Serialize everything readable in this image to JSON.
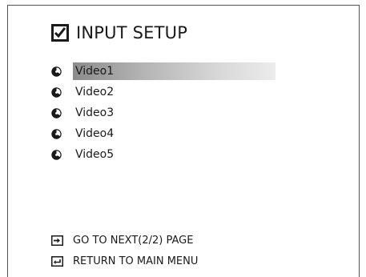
{
  "title": "INPUT SETUP",
  "inputs": [
    {
      "label": "Video1",
      "selected": true
    },
    {
      "label": "Video2",
      "selected": false
    },
    {
      "label": "Video3",
      "selected": false
    },
    {
      "label": "Video4",
      "selected": false
    },
    {
      "label": "Video5",
      "selected": false
    }
  ],
  "footer": {
    "next_page": "GO TO NEXT(2/2) PAGE",
    "return_main": "RETURN TO MAIN MENU"
  },
  "icons": {
    "title": "checkbox-icon",
    "bullet": "input-source-icon",
    "next": "arrow-right-icon",
    "return": "return-icon"
  },
  "colors": {
    "text": "#1a1a1a",
    "selection_start": "#8c8c8c",
    "selection_end": "#ececec"
  }
}
